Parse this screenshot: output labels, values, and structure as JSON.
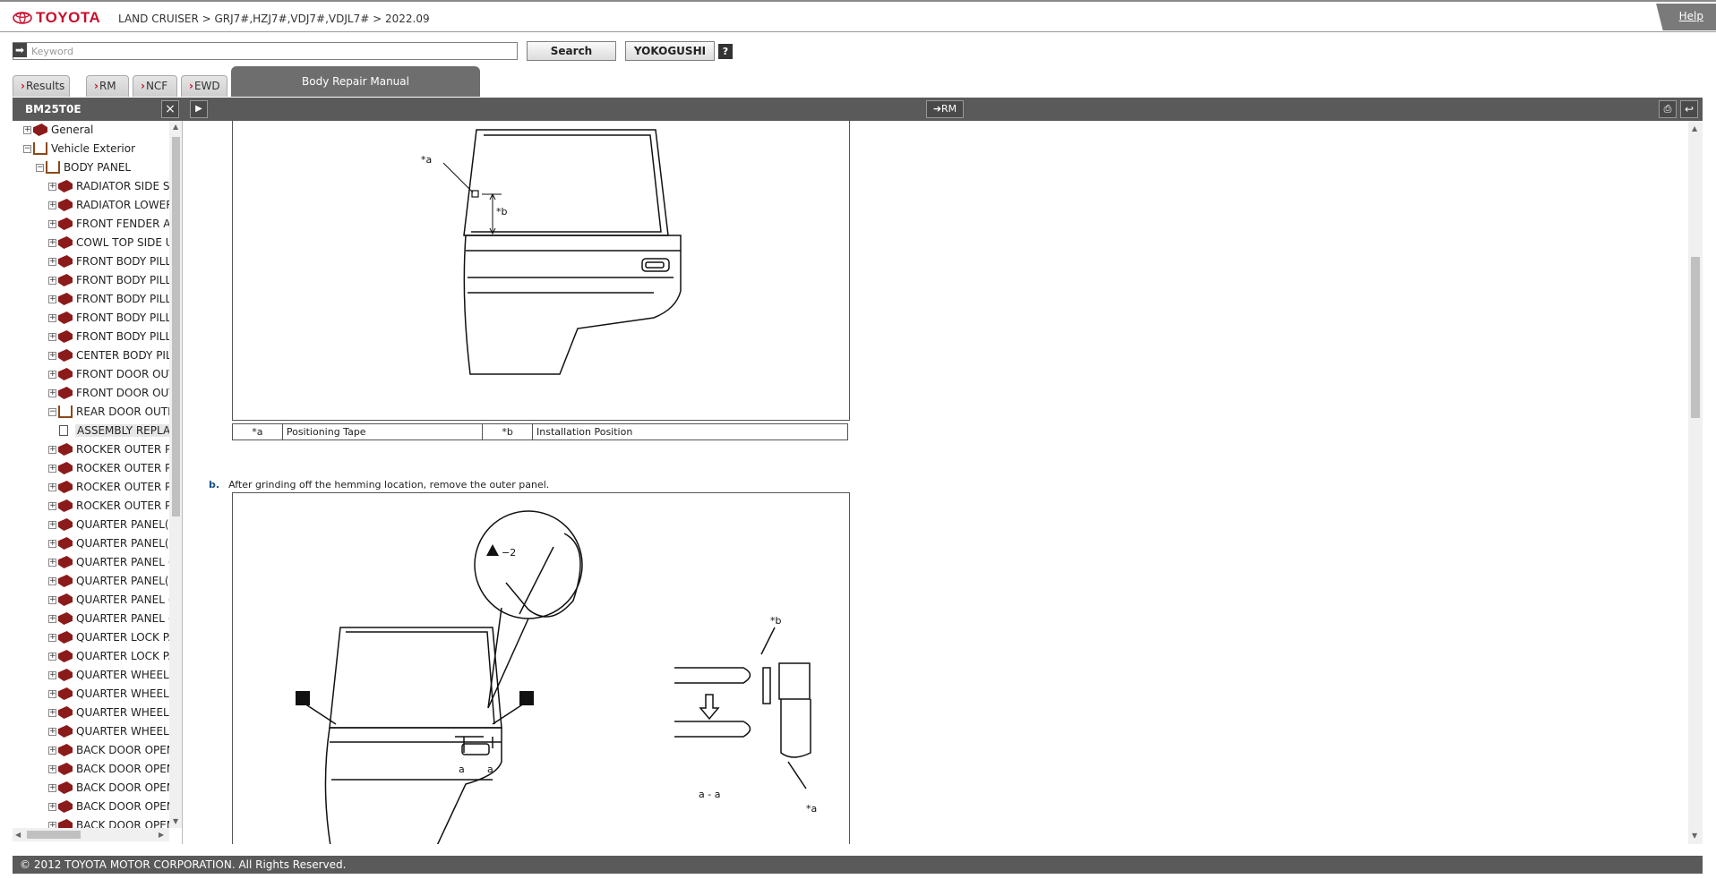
{
  "header": {
    "logo_text": "TOYOTA",
    "breadcrumb": "LAND CRUISER > GRJ7#,HZJ7#,VDJ7#,VDJL7# > 2022.09",
    "help": "Help"
  },
  "search": {
    "placeholder": "Keyword",
    "search_button": "Search",
    "yokogushi_button": "YOKOGUSHI",
    "help_button": "?"
  },
  "tabs": {
    "results": "Results",
    "rm": "RM",
    "ncf": "NCF",
    "ewd": "EWD",
    "active": "Body Repair Manual"
  },
  "toolbar": {
    "doc_id": "BM25T0E",
    "close": "×",
    "to_rm": "RM"
  },
  "tree": {
    "items": [
      {
        "label": "General",
        "level": 1,
        "state": "closed"
      },
      {
        "label": "Vehicle Exterior",
        "level": 1,
        "state": "open"
      },
      {
        "label": "BODY PANEL",
        "level": 2,
        "state": "open"
      },
      {
        "label": "RADIATOR SIDE S",
        "level": 3,
        "state": "closed"
      },
      {
        "label": "RADIATOR LOWER",
        "level": 3,
        "state": "closed"
      },
      {
        "label": "FRONT FENDER AI",
        "level": 3,
        "state": "closed"
      },
      {
        "label": "COWL TOP SIDE U",
        "level": 3,
        "state": "closed"
      },
      {
        "label": "FRONT BODY PILL",
        "level": 3,
        "state": "closed"
      },
      {
        "label": "FRONT BODY PILL",
        "level": 3,
        "state": "closed"
      },
      {
        "label": "FRONT BODY PILL",
        "level": 3,
        "state": "closed"
      },
      {
        "label": "FRONT BODY PILL",
        "level": 3,
        "state": "closed"
      },
      {
        "label": "FRONT BODY PILL",
        "level": 3,
        "state": "closed"
      },
      {
        "label": "CENTER BODY PIL",
        "level": 3,
        "state": "closed"
      },
      {
        "label": "FRONT DOOR OUT",
        "level": 3,
        "state": "closed"
      },
      {
        "label": "FRONT DOOR OUT",
        "level": 3,
        "state": "closed"
      },
      {
        "label": "REAR DOOR OUTE",
        "level": 3,
        "state": "open"
      },
      {
        "label": "ASSEMBLY REPLA",
        "level": 4,
        "state": "doc"
      },
      {
        "label": "ROCKER OUTER P",
        "level": 3,
        "state": "closed"
      },
      {
        "label": "ROCKER OUTER P",
        "level": 3,
        "state": "closed"
      },
      {
        "label": "ROCKER OUTER P",
        "level": 3,
        "state": "closed"
      },
      {
        "label": "ROCKER OUTER P",
        "level": 3,
        "state": "closed"
      },
      {
        "label": "QUARTER PANEL(",
        "level": 3,
        "state": "closed"
      },
      {
        "label": "QUARTER PANEL(",
        "level": 3,
        "state": "closed"
      },
      {
        "label": "QUARTER PANEL (",
        "level": 3,
        "state": "closed"
      },
      {
        "label": "QUARTER PANEL(",
        "level": 3,
        "state": "closed"
      },
      {
        "label": "QUARTER PANEL (",
        "level": 3,
        "state": "closed"
      },
      {
        "label": "QUARTER PANEL (",
        "level": 3,
        "state": "closed"
      },
      {
        "label": "QUARTER LOCK P.",
        "level": 3,
        "state": "closed"
      },
      {
        "label": "QUARTER LOCK P.",
        "level": 3,
        "state": "closed"
      },
      {
        "label": "QUARTER WHEEL",
        "level": 3,
        "state": "closed"
      },
      {
        "label": "QUARTER WHEEL",
        "level": 3,
        "state": "closed"
      },
      {
        "label": "QUARTER WHEEL",
        "level": 3,
        "state": "closed"
      },
      {
        "label": "QUARTER WHEEL",
        "level": 3,
        "state": "closed"
      },
      {
        "label": "BACK DOOR OPEN",
        "level": 3,
        "state": "closed"
      },
      {
        "label": "BACK DOOR OPEN",
        "level": 3,
        "state": "closed"
      },
      {
        "label": "BACK DOOR OPEN",
        "level": 3,
        "state": "closed"
      },
      {
        "label": "BACK DOOR OPEN",
        "level": 3,
        "state": "closed"
      },
      {
        "label": "BACK DOOR OPEN",
        "level": 3,
        "state": "closed"
      }
    ]
  },
  "content": {
    "figure1": {
      "label_a": "*a",
      "label_b": "*b"
    },
    "caption": {
      "key_a": "*a",
      "text_a": "Positioning Tape",
      "key_b": "*b",
      "text_b": "Installation Position"
    },
    "step_b": {
      "label": "b.",
      "text": "After grinding off the hemming location, remove the outer panel."
    },
    "figure2": {
      "caution": "−2",
      "label_a_left": "a",
      "label_a_right": "a",
      "section": "a - a",
      "label_b": "*b",
      "label_a_star": "*a"
    }
  },
  "footer": {
    "copyright": "© 2012 TOYOTA MOTOR CORPORATION. All Rights Reserved."
  },
  "colors": {
    "brand_red": "#c8102e",
    "toolbar_gray": "#5a5a5a",
    "book_red": "#8b1a1a"
  }
}
